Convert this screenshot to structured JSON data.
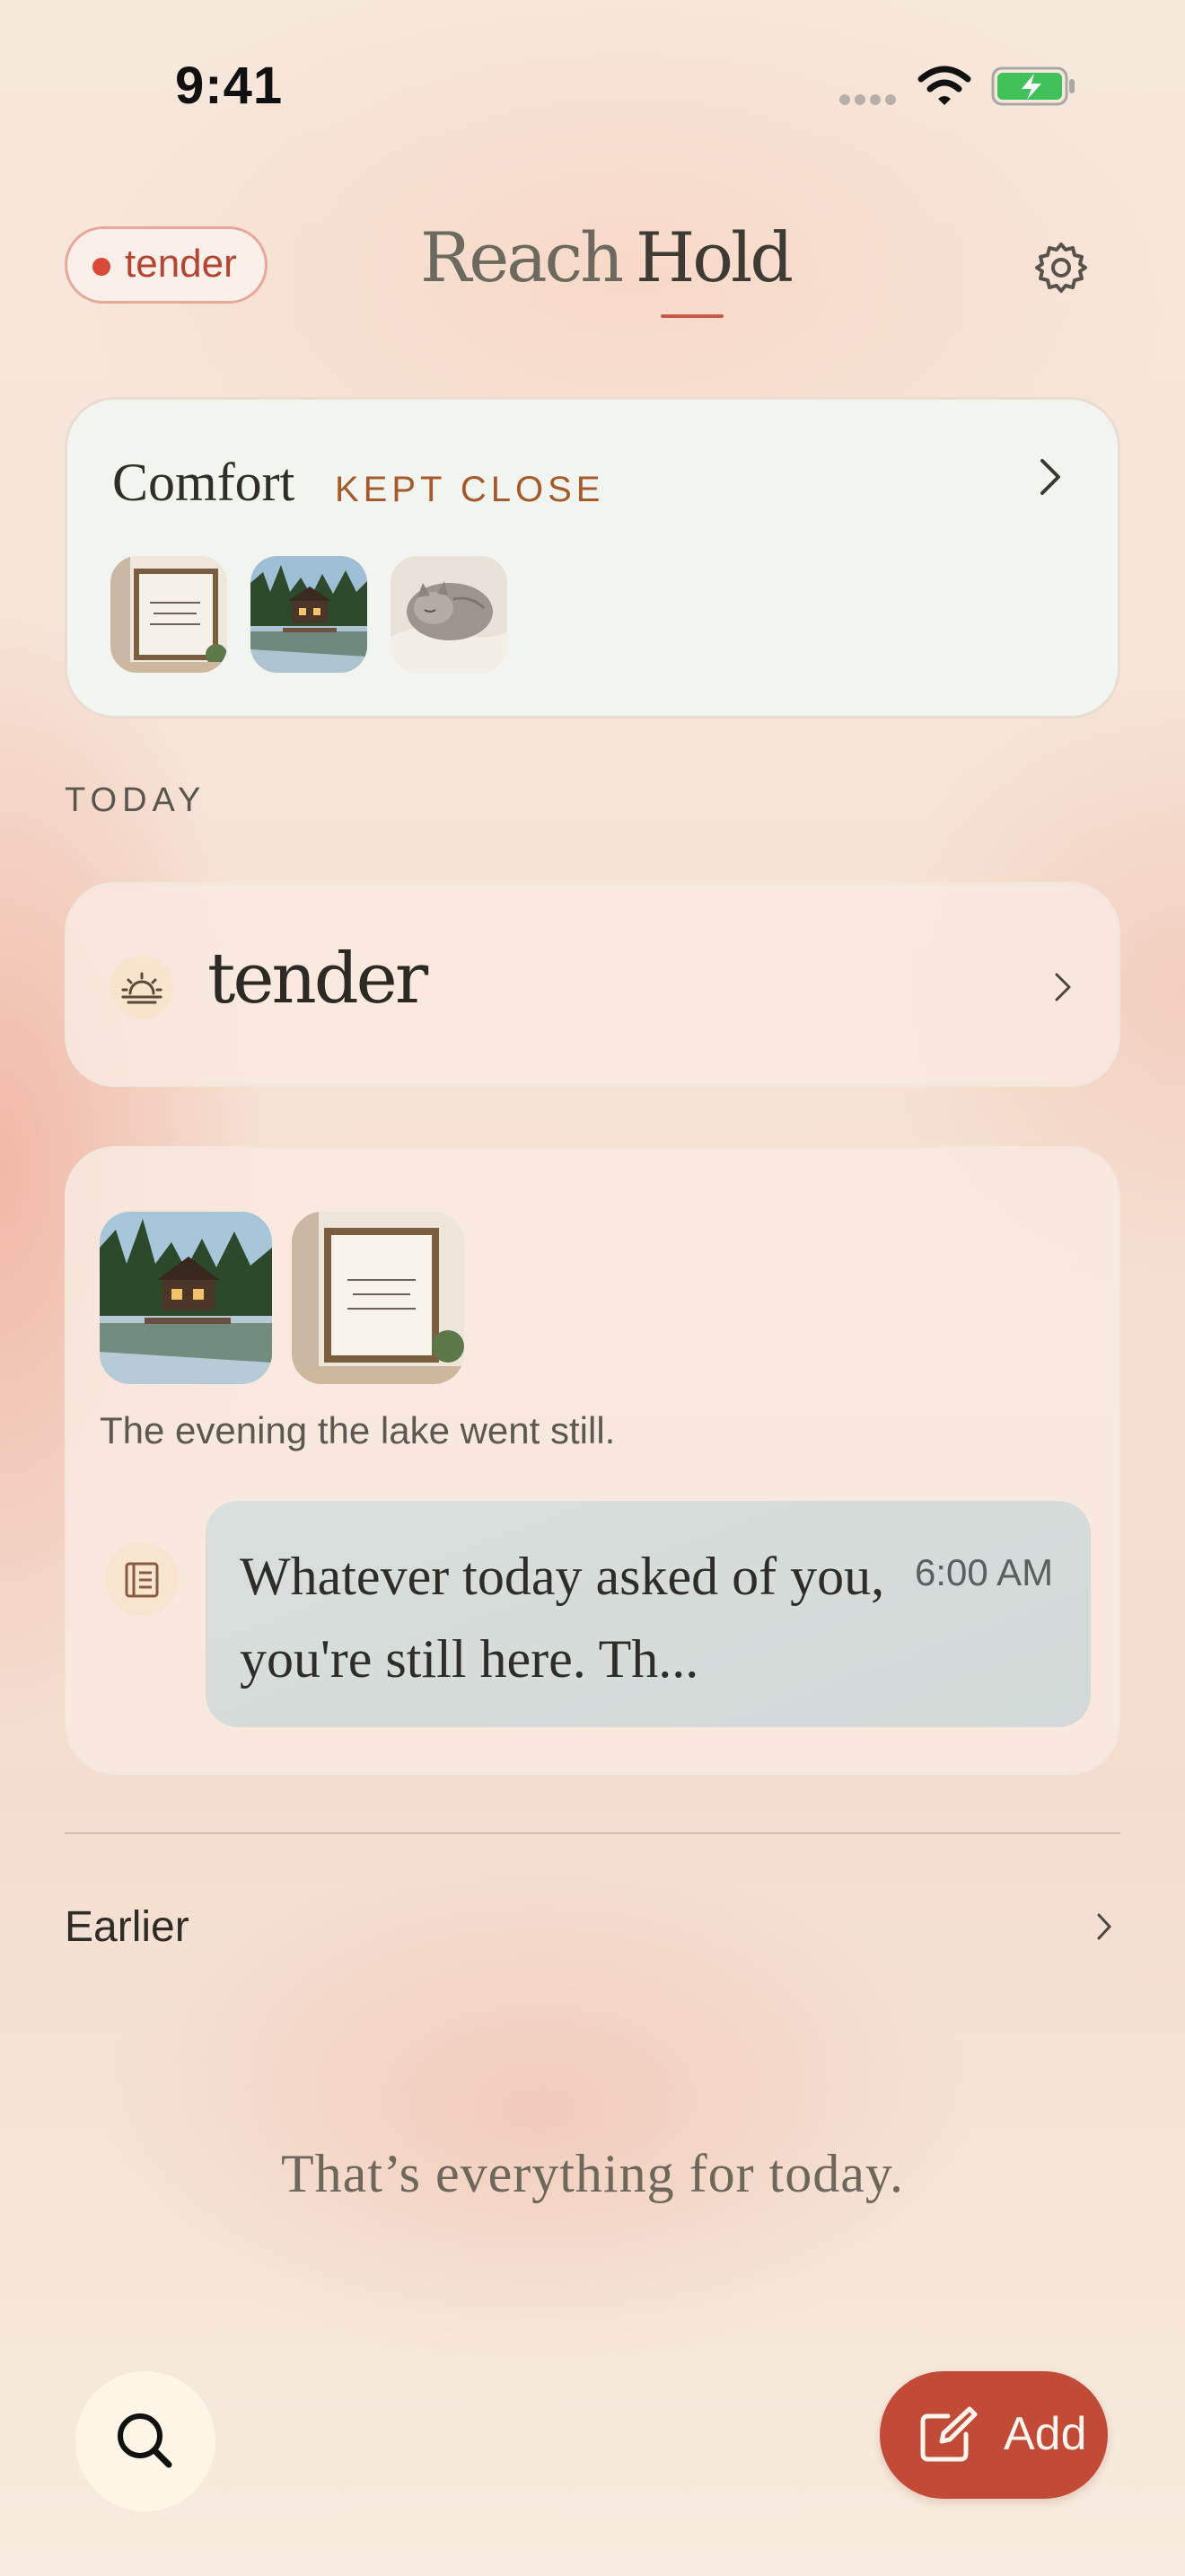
{
  "status_bar": {
    "time": "9:41"
  },
  "header": {
    "mood_pill": "tender",
    "tabs": [
      {
        "label": "Reach",
        "active": false
      },
      {
        "label": "Hold",
        "active": true
      }
    ]
  },
  "comfort": {
    "title": "Comfort",
    "tag": "KEPT CLOSE",
    "thumbnails": [
      "quote-poster",
      "lake-cabin",
      "sleeping-cat"
    ]
  },
  "today": {
    "section_label": "TODAY",
    "mood": {
      "label": "tender",
      "icon": "sunrise-icon"
    },
    "entry": {
      "photos": [
        "lake-cabin",
        "quote-poster"
      ],
      "caption": "The evening the lake went still.",
      "note": {
        "text": "Whatever today asked of you, you're still here. Th...",
        "time": "6:00 AM"
      }
    }
  },
  "earlier": {
    "label": "Earlier"
  },
  "footer_message": "That’s everything for today.",
  "actions": {
    "add_label": "Add"
  },
  "colors": {
    "accent": "#c24b38",
    "mood_dot": "#d94a37",
    "comfort_card": "#f2f5ef"
  }
}
